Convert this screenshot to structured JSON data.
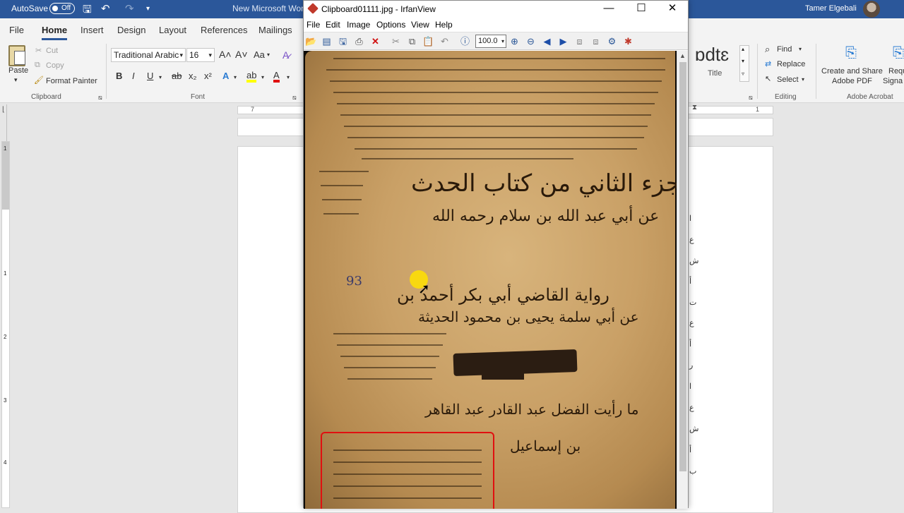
{
  "word": {
    "autosave_label": "AutoSave",
    "autosave_state": "Off",
    "doc_title": "New Microsoft Word",
    "user_name": "Tamer Elgebali",
    "tabs": [
      "File",
      "Home",
      "Insert",
      "Design",
      "Layout",
      "References",
      "Mailings"
    ],
    "active_tab": "Home",
    "clipboard": {
      "paste": "Paste",
      "cut": "Cut",
      "copy": "Copy",
      "format_painter": "Format Painter",
      "group_label": "Clipboard"
    },
    "font": {
      "family": "Traditional Arabic",
      "size": "16",
      "group_label": "Font",
      "bold": "B",
      "italic": "I",
      "underline": "U",
      "strike": "ab",
      "subscript": "x₂",
      "superscript": "x²",
      "grow": "A˄",
      "shrink": "A˅",
      "change_case": "Aa",
      "text_effects": "A",
      "highlight": "ab",
      "font_color": "A"
    },
    "styles": {
      "preview": "ɒdtɛ",
      "title": "Title"
    },
    "editing": {
      "find": "Find",
      "replace": "Replace",
      "select": "Select",
      "group_label": "Editing"
    },
    "adobe": {
      "create_share": "Create and Share",
      "adobe_pdf": "Adobe PDF",
      "request": "Requ",
      "signatures": "Signa",
      "group_label": "Adobe Acrobat"
    },
    "ruler": {
      "left_num": "7",
      "right_num": "1"
    },
    "ruler_v_numbers": [
      "1",
      "1",
      "2",
      "3",
      "4"
    ],
    "page_text_right": [
      "ا",
      "ع",
      "ش",
      "أ",
      "ت",
      "ع",
      "أ",
      "ر",
      "ا",
      "ع",
      "ش",
      "أ",
      "ب"
    ]
  },
  "irfanview": {
    "title": "Clipboard01111.jpg - IrfanView",
    "menu": [
      "File",
      "Edit",
      "Image",
      "Options",
      "View",
      "Help"
    ],
    "zoom": "100.0",
    "image": {
      "heading_line1": "الجزء الثاني من كتاب الحدث",
      "heading_line2": "عن أبي عبد الله بن سلام رحمه الله",
      "number": "93",
      "line3": "رواية القاضي أبي بكر أحمد بن",
      "line4": "عن أبي سلمة يحيى بن محمود الحديثة",
      "line5": "ما رأيت الفضل عبد القادر عبد القاهر",
      "line6": "بن إسماعيل"
    }
  }
}
